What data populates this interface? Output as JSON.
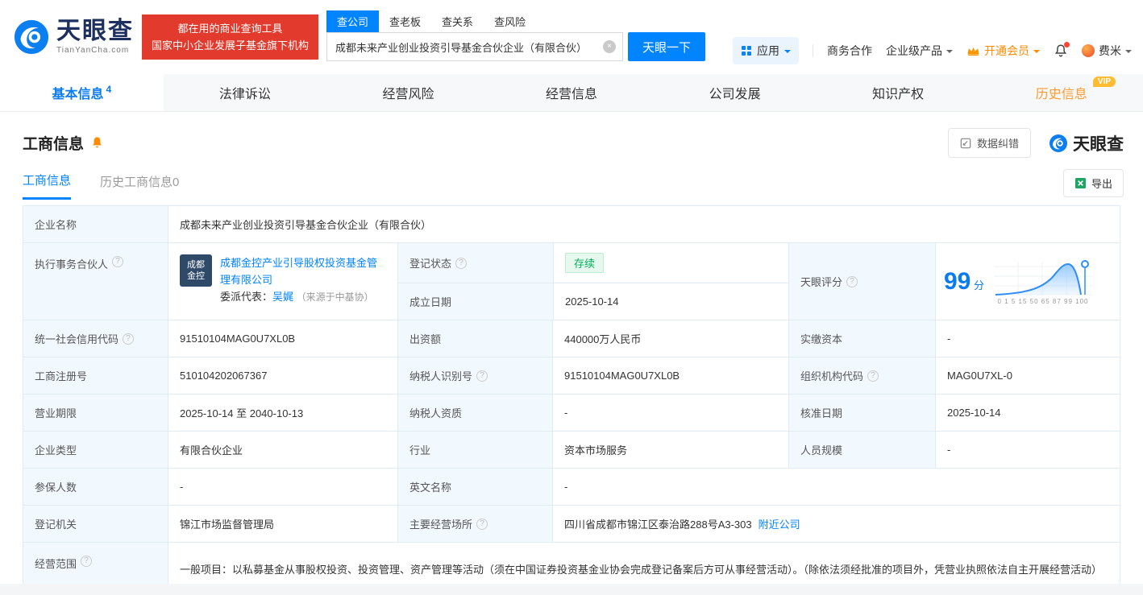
{
  "header": {
    "logo": {
      "name": "天眼查",
      "domain": "TianYanCha.com"
    },
    "banner": {
      "line1": "都在用的商业查询工具",
      "line2": "国家中小企业发展子基金旗下机构"
    },
    "search": {
      "tabs": [
        "查公司",
        "查老板",
        "查关系",
        "查风险"
      ],
      "value": "成都未来产业创业投资引导基金合伙企业（有限合伙）",
      "button": "天眼一下"
    },
    "menu": {
      "apps": "应用",
      "cooperation": "商务合作",
      "enterprise_products": "企业级产品",
      "vip": "开通会员",
      "user": "费米"
    }
  },
  "nav_tabs": {
    "basic": "基本信息",
    "basic_count": "4",
    "legal": "法律诉讼",
    "risk": "经营风险",
    "operation": "经营信息",
    "development": "公司发展",
    "ip": "知识产权",
    "history": "历史信息",
    "history_vip": "VIP"
  },
  "section": {
    "title": "工商信息",
    "correction": "数据纠错",
    "brand": "天眼查",
    "subtab_active": "工商信息",
    "subtab_history": "历史工商信息0",
    "export": "导出"
  },
  "table": {
    "name": {
      "label": "企业名称",
      "value": "成都未来产业创业投资引导基金合伙企业（有限合伙）"
    },
    "partner": {
      "label": "执行事务合伙人",
      "logo_line1": "成都",
      "logo_line2": "金控",
      "company": "成都金控产业引导股权投资基金管理有限公司",
      "rep_label": "委派代表：",
      "rep_name": "吴娓",
      "rep_source": "（来源于中基协）"
    },
    "status": {
      "label": "登记状态",
      "value": "存续"
    },
    "established": {
      "label": "成立日期",
      "value": "2025-10-14"
    },
    "score": {
      "label": "天眼评分",
      "value": "99",
      "unit": "分",
      "axis": "0  1  5  15  50  65  87  99 100"
    },
    "rows": [
      {
        "l1": "统一社会信用代码",
        "v1": "91510104MAG0U7XL0B",
        "l2": "出资额",
        "v2": "440000万人民币",
        "l3": "实缴资本",
        "v3": "-"
      },
      {
        "l1": "工商注册号",
        "v1": "510104202067367",
        "l2": "纳税人识别号",
        "v2": "91510104MAG0U7XL0B",
        "l3": "组织机构代码",
        "v3": "MAG0U7XL-0"
      },
      {
        "l1": "营业期限",
        "v1": "2025-10-14 至 2040-10-13",
        "l2": "纳税人资质",
        "v2": "-",
        "l3": "核准日期",
        "v3": "2025-10-14"
      },
      {
        "l1": "企业类型",
        "v1": "有限合伙企业",
        "l2": "行业",
        "v2": "资本市场服务",
        "l3": "人员规模",
        "v3": "-"
      }
    ],
    "insured": {
      "label": "参保人数",
      "value": "-"
    },
    "english": {
      "label": "英文名称",
      "value": "-"
    },
    "authority": {
      "label": "登记机关",
      "value": "锦江市场监督管理局"
    },
    "address": {
      "label": "主要经营场所",
      "value": "四川省成都市锦江区泰治路288号A3-303",
      "link": "附近公司"
    },
    "scope": {
      "label": "经营范围",
      "value": "一般项目：以私募基金从事股权投资、投资管理、资产管理等活动（须在中国证券投资基金业协会完成登记备案后方可从事经营活动）。（除依法须经批准的项目外，凭营业执照依法自主开展经营活动）"
    }
  },
  "colors": {
    "accent": "#0084ff",
    "banner_red": "#e23b2e",
    "vip_orange": "#ff8a00",
    "status_green": "#00b35a"
  }
}
